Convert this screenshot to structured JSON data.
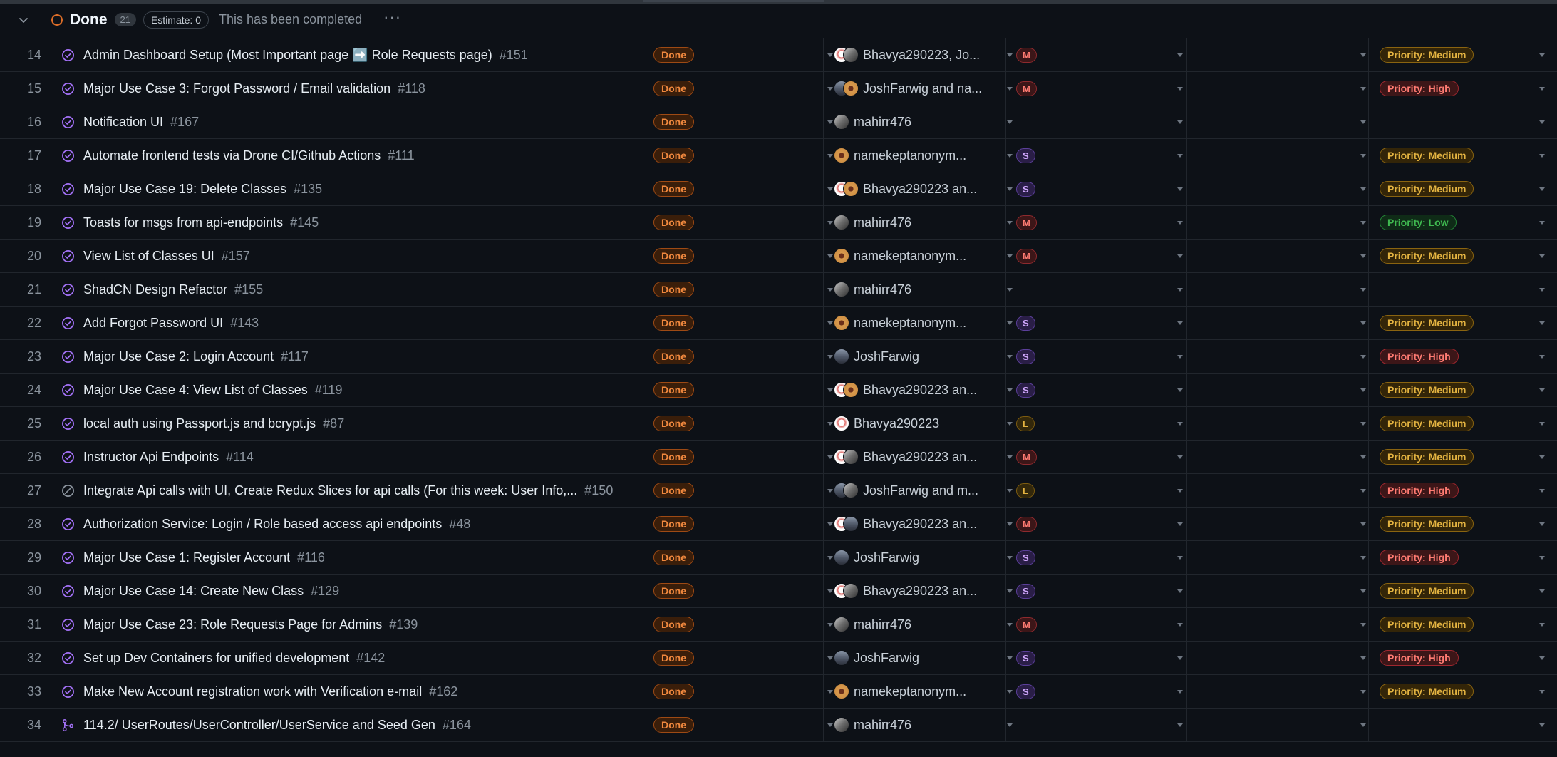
{
  "group": {
    "title": "Done",
    "count": "21",
    "estimate": "Estimate: 0",
    "description": "This has been completed"
  },
  "colors": {
    "done_accent": "#db6d28",
    "issue_closed": "#a371f7",
    "priority_medium": "#e3b341",
    "priority_high": "#ff7b72",
    "priority_low": "#3fb950"
  },
  "rows": [
    {
      "num": "14",
      "icon": "issue-closed-icon",
      "title": "Admin Dashboard Setup (Most Important page ➡️ Role Requests page)",
      "issue": "#151",
      "status": "Done",
      "avatars": [
        "b",
        "m"
      ],
      "assignees": "Bhavya290223, Jo...",
      "size": "M",
      "priority": "Priority: Medium",
      "priority_level": "Medium"
    },
    {
      "num": "15",
      "icon": "issue-closed-icon",
      "title": "Major Use Case 3: Forgot Password / Email validation",
      "issue": "#118",
      "status": "Done",
      "avatars": [
        "j",
        "n"
      ],
      "assignees": "JoshFarwig and na...",
      "size": "M",
      "priority": "Priority: High",
      "priority_level": "High"
    },
    {
      "num": "16",
      "icon": "issue-closed-icon",
      "title": "Notification UI",
      "issue": "#167",
      "status": "Done",
      "avatars": [
        "m"
      ],
      "assignees": "mahirr476",
      "size": "",
      "priority": "",
      "priority_level": ""
    },
    {
      "num": "17",
      "icon": "issue-closed-icon",
      "title": "Automate frontend tests via Drone CI/Github Actions",
      "issue": "#111",
      "status": "Done",
      "avatars": [
        "n"
      ],
      "assignees": "namekeptanonym...",
      "size": "S",
      "priority": "Priority: Medium",
      "priority_level": "Medium"
    },
    {
      "num": "18",
      "icon": "issue-closed-icon",
      "title": "Major Use Case 19: Delete Classes",
      "issue": "#135",
      "status": "Done",
      "avatars": [
        "b",
        "n"
      ],
      "assignees": "Bhavya290223 an...",
      "size": "S",
      "priority": "Priority: Medium",
      "priority_level": "Medium"
    },
    {
      "num": "19",
      "icon": "issue-closed-icon",
      "title": "Toasts for msgs from api-endpoints",
      "issue": "#145",
      "status": "Done",
      "avatars": [
        "m"
      ],
      "assignees": "mahirr476",
      "size": "M",
      "priority": "Priority: Low",
      "priority_level": "Low"
    },
    {
      "num": "20",
      "icon": "issue-closed-icon",
      "title": "View List of Classes UI",
      "issue": "#157",
      "status": "Done",
      "avatars": [
        "n"
      ],
      "assignees": "namekeptanonym...",
      "size": "M",
      "priority": "Priority: Medium",
      "priority_level": "Medium"
    },
    {
      "num": "21",
      "icon": "issue-closed-icon",
      "title": "ShadCN Design Refactor",
      "issue": "#155",
      "status": "Done",
      "avatars": [
        "m"
      ],
      "assignees": "mahirr476",
      "size": "",
      "priority": "",
      "priority_level": ""
    },
    {
      "num": "22",
      "icon": "issue-closed-icon",
      "title": "Add Forgot Password UI",
      "issue": "#143",
      "status": "Done",
      "avatars": [
        "n"
      ],
      "assignees": "namekeptanonym...",
      "size": "S",
      "priority": "Priority: Medium",
      "priority_level": "Medium"
    },
    {
      "num": "23",
      "icon": "issue-closed-icon",
      "title": "Major Use Case 2: Login Account",
      "issue": "#117",
      "status": "Done",
      "avatars": [
        "j"
      ],
      "assignees": "JoshFarwig",
      "size": "S",
      "priority": "Priority: High",
      "priority_level": "High"
    },
    {
      "num": "24",
      "icon": "issue-closed-icon",
      "title": "Major Use Case 4: View List of Classes",
      "issue": "#119",
      "status": "Done",
      "avatars": [
        "b",
        "n"
      ],
      "assignees": "Bhavya290223 an...",
      "size": "S",
      "priority": "Priority: Medium",
      "priority_level": "Medium"
    },
    {
      "num": "25",
      "icon": "issue-closed-icon",
      "title": "local auth using Passport.js and bcrypt.js",
      "issue": "#87",
      "status": "Done",
      "avatars": [
        "b"
      ],
      "assignees": "Bhavya290223",
      "size": "L",
      "priority": "Priority: Medium",
      "priority_level": "Medium"
    },
    {
      "num": "26",
      "icon": "issue-closed-icon",
      "title": "Instructor Api Endpoints",
      "issue": "#114",
      "status": "Done",
      "avatars": [
        "b",
        "m"
      ],
      "assignees": "Bhavya290223 an...",
      "size": "M",
      "priority": "Priority: Medium",
      "priority_level": "Medium"
    },
    {
      "num": "27",
      "icon": "issue-not-planned-icon",
      "title": "Integrate Api calls with UI, Create Redux Slices for api calls (For this week: User Info,...",
      "issue": "#150",
      "status": "Done",
      "avatars": [
        "j",
        "m"
      ],
      "assignees": "JoshFarwig and m...",
      "size": "L",
      "priority": "Priority: High",
      "priority_level": "High"
    },
    {
      "num": "28",
      "icon": "issue-closed-icon",
      "title": "Authorization Service: Login / Role based access api endpoints",
      "issue": "#48",
      "status": "Done",
      "avatars": [
        "b",
        "j"
      ],
      "assignees": "Bhavya290223 an...",
      "size": "M",
      "priority": "Priority: Medium",
      "priority_level": "Medium"
    },
    {
      "num": "29",
      "icon": "issue-closed-icon",
      "title": "Major Use Case 1: Register Account",
      "issue": "#116",
      "status": "Done",
      "avatars": [
        "j"
      ],
      "assignees": "JoshFarwig",
      "size": "S",
      "priority": "Priority: High",
      "priority_level": "High"
    },
    {
      "num": "30",
      "icon": "issue-closed-icon",
      "title": "Major Use Case 14: Create New Class",
      "issue": "#129",
      "status": "Done",
      "avatars": [
        "b",
        "m"
      ],
      "assignees": "Bhavya290223 an...",
      "size": "S",
      "priority": "Priority: Medium",
      "priority_level": "Medium"
    },
    {
      "num": "31",
      "icon": "issue-closed-icon",
      "title": "Major Use Case 23: Role Requests Page for Admins",
      "issue": "#139",
      "status": "Done",
      "avatars": [
        "m"
      ],
      "assignees": "mahirr476",
      "size": "M",
      "priority": "Priority: Medium",
      "priority_level": "Medium"
    },
    {
      "num": "32",
      "icon": "issue-closed-icon",
      "title": "Set up Dev Containers for unified development",
      "issue": "#142",
      "status": "Done",
      "avatars": [
        "j"
      ],
      "assignees": "JoshFarwig",
      "size": "S",
      "priority": "Priority: High",
      "priority_level": "High"
    },
    {
      "num": "33",
      "icon": "issue-closed-icon",
      "title": "Make New Account registration work with Verification e-mail",
      "issue": "#162",
      "status": "Done",
      "avatars": [
        "n"
      ],
      "assignees": "namekeptanonym...",
      "size": "S",
      "priority": "Priority: Medium",
      "priority_level": "Medium"
    },
    {
      "num": "34",
      "icon": "pull-request-merged-icon",
      "title": "114.2/ UserRoutes/UserController/UserService and Seed Gen",
      "issue": "#164",
      "status": "Done",
      "avatars": [
        "m"
      ],
      "assignees": "mahirr476",
      "size": "",
      "priority": "",
      "priority_level": ""
    }
  ]
}
